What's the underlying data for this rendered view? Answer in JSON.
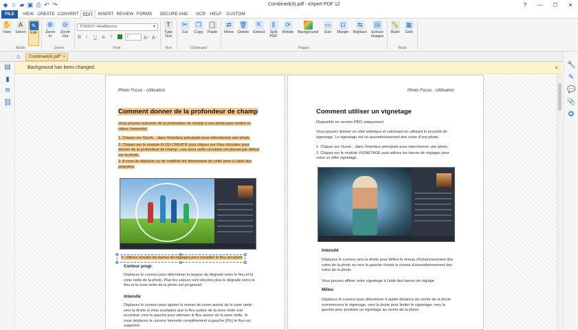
{
  "window": {
    "title": "Combined(4).pdf  -  eXpert PDF 12"
  },
  "menu": {
    "file": "FILE",
    "tabs": [
      "VIEW",
      "CREATE",
      "CONVERT",
      "EDIT",
      "INSERT",
      "REVIEW",
      "FORMS",
      "SECURE AND SIGN",
      "OCR",
      "HELP",
      "CUSTOM"
    ],
    "active": "EDIT"
  },
  "ribbon": {
    "mode": {
      "view": "View",
      "select": "Select",
      "edit": "Edit",
      "group": "Mode"
    },
    "zoom": {
      "zoom_in": "Zoom In",
      "zoom_out": "Zoom Out",
      "group": "Zoom"
    },
    "font": {
      "name": "TOKEDY+ArialNarrow",
      "group": "Font"
    },
    "text": {
      "type_text": "Type Text",
      "group": "Text"
    },
    "clipboard": {
      "cut": "Cut",
      "copy": "Copy",
      "paste": "Paste",
      "group": "Clipboard"
    },
    "pages": {
      "move": "Move",
      "delete": "Delete",
      "extract": "Extract",
      "split": "Split PDF",
      "rotate": "Rotate",
      "background": "Background",
      "size": "Size",
      "margin": "Margin",
      "replace": "Replace",
      "extract_images": "Extract Images",
      "group": "Pages"
    },
    "tools": {
      "ruler": "Ruler",
      "grid": "Grid",
      "group": "Tools"
    }
  },
  "doc_tab": {
    "label": "Combined(4).pdf*"
  },
  "notification": {
    "text": "Background has been changed."
  },
  "left_page": {
    "header": "Photo Focus - Utilisation",
    "heading": "Comment donner de la profondeur de champ",
    "intro": "Vous pouvez redonner de la profondeur de champ à une photo pour mettre en valeur l'essentiel.",
    "steps": [
      "1. Cliquez sur Ouvrir... dans l'interface principale pour sélectionner une photo.",
      "2. Cliquez sur le module FLOU CREATIF puis cliquez sur Flou circulaire pour donner de la profondeur de champ ; une zone nette circulaire est placée par défaut sur la photo.",
      "3. A vous de déplacer ou de redéfinir les dimensions de cette zone à l'aide des poignées."
    ],
    "selected_step": "4. Utilisez ensuite les barres de réglages pour travailler le flou circulaire",
    "contour_title": "Contour progr.",
    "contour_text": "Déplacez le curseur pour déterminer la largeur du dégradé entre le flou et la zone nette de la photo. Plus les valeurs sont élevées plus le dégradé entre le flou et la zone nette de la photo est progressif.",
    "intensity_title": "Intensité",
    "intensity_text": "Déplacez le curseur pour ajuster le niveau de zoom autour de la zone nette : vers la droite si vous souhaitez que le flou autour de la zone nette soit accentué, vers la gauche pour atténuer le flou autour de la zone nette. Si vous déplacez le curseur Intensité complètement à gauche (0%) le flou est supprimé."
  },
  "right_page": {
    "header": "Photo Focus - Utilisation",
    "heading": "Comment utiliser un vignetage",
    "note": "Disponible en version PRO uniquement",
    "intro": "Vous pouvez donner un côté artistique et valorisant en utilisant le procédé de vignetage. Le vignetage est un assombrissement des coins d'une photo.",
    "steps": [
      "1. Cliquez sur Ouvrir... dans l'interface principale pour sélectionner une photo.",
      "2. Cliquez sur le module VIGNETAGE puis utilisez les barres de réglages pour créer un effet vignetage."
    ],
    "intensity_title": "Intensité",
    "intensity_text": "Déplacez le curseur vers la droite pour définir le niveau d'éclaircissement des coins de la photo ou vers la gauche choisir le niveau d'assombrissement des coins de la photo.",
    "opacity_text": "Vous pouvez affiner votre vignetage à l'aide des barres de réglage :",
    "middle_title": "Milieu",
    "middle_text": "Déplacez le curseur pour déterminer à quelle distance du centre de la photo commencera le vignetage, vers la droite pour limiter le vignetage, vers la gauche pour produire un vignetage au centre de la photo."
  },
  "colors": {
    "accent": "#1f5aa8",
    "highlight": "#f7c989",
    "notification_bg": "#fdf3cd",
    "active_tool": "#fbe3b0"
  }
}
